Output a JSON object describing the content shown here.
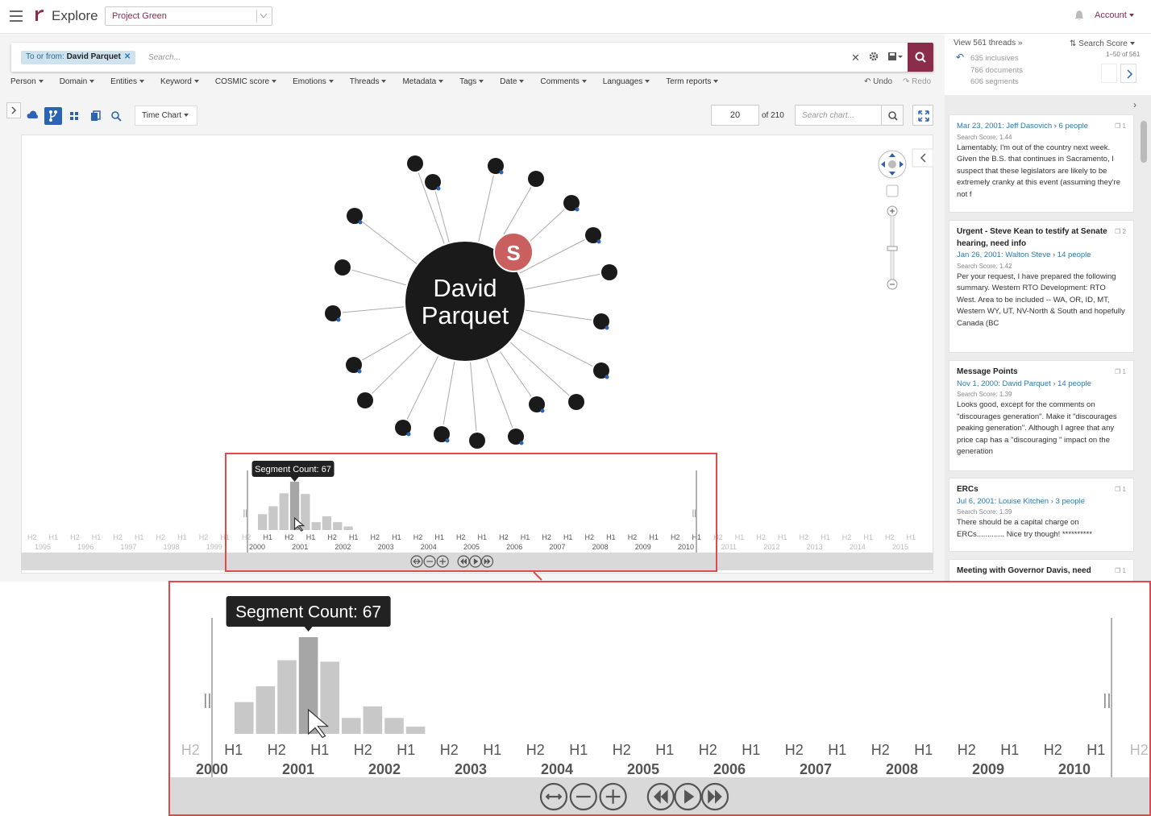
{
  "app": {
    "title": "Explore",
    "project": "Project Green",
    "account_label": "Account"
  },
  "search": {
    "chip_prefix": "To or from:",
    "chip_value": "David Parquet",
    "placeholder": "Search..."
  },
  "filters": [
    "Person",
    "Domain",
    "Entities",
    "Keyword",
    "COSMIC score",
    "Emotions",
    "Threads",
    "Metadata",
    "Tags",
    "Date",
    "Comments",
    "Languages",
    "Term reports"
  ],
  "history": {
    "undo": "Undo",
    "redo": "Redo"
  },
  "toolbar": {
    "chart_type": "Time Chart",
    "page_value": "20",
    "page_of": "of 210",
    "chart_search_placeholder": "Search chart..."
  },
  "graph": {
    "center_line1": "David",
    "center_line2": "Parquet",
    "badge": "S"
  },
  "sidebar": {
    "threads_link": "View 561 threads »",
    "sort_label": "Search Score",
    "stats": [
      "635 inclusives",
      "766 documents",
      "606 segments"
    ],
    "range": "1–50 of 561",
    "cards": [
      {
        "title": "",
        "meta": "Mar 23, 2001: Jeff Dasovich › 6 people",
        "score": "Search Score: 1.44",
        "count": "1",
        "body": "Lamentably, I'm out of the country next week. Given the B.S. that continues in Sacramento, I suspect that these legislators are likely to be extremely cranky at this event (assuming they're not f"
      },
      {
        "title": "Urgent - Steve Kean to testify at Senate hearing, need info",
        "meta": "Jan 26, 2001: Walton Steve › 14 people",
        "score": "Search Score: 1.42",
        "count": "2",
        "body": "Per your request, I have prepared the following summary. Western RTO Development: RTO West. Area to be included -- WA, OR, ID, MT, Western WY, UT, NV-North & South and hopefully Canada (BC"
      },
      {
        "title": "Message Points",
        "meta": "Nov 1, 2000: David Parquet › 14 people",
        "score": "Search Score: 1.39",
        "count": "1",
        "body": "Looks good, except for the comments on \"discourages generation\". Make it \"discourages peaking generation\". Although I agree that any price cap has a \"discouraging \" impact on the generation"
      },
      {
        "title": "ERCs",
        "meta": "Jul 6, 2001: Louise Kitchen › 3 people",
        "score": "Search Score: 1.39",
        "count": "1",
        "body": "There should be a capital charge on ERCs............. Nice try though! **********"
      },
      {
        "title": "Meeting with Governor Davis, need",
        "meta": "",
        "score": "",
        "count": "1",
        "body": ""
      }
    ]
  },
  "timeline": {
    "tooltip": "Segment Count: 67",
    "half_labels": [
      "H1",
      "H2"
    ],
    "years": [
      "1995",
      "1996",
      "1997",
      "1998",
      "1999",
      "2000",
      "2001",
      "2002",
      "2003",
      "2004",
      "2005",
      "2006",
      "2007",
      "2008",
      "2009",
      "2010",
      "2011",
      "2012",
      "2013",
      "2014",
      "2015"
    ],
    "first_label": "2",
    "big_first_half": "H2",
    "big_first_year": "99"
  },
  "chart_data": {
    "type": "bar",
    "title": "",
    "categories": [
      "2000 H1",
      "2000 H2",
      "2001 H1",
      "2001 H2",
      "2002 H1",
      "2002 H2",
      "2003 H1",
      "2003 H2"
    ],
    "values": [
      22,
      33,
      51,
      67,
      50,
      11,
      19,
      11,
      5
    ],
    "highlighted_category": "2001 H1",
    "highlighted_value": 67
  },
  "colors": {
    "brand": "#8a2d4a",
    "active": "#2b64b5",
    "link": "#2a7ab0",
    "highlight_box": "#e04a4a",
    "bar": "#c8c8c8",
    "bar_selected": "#a6a6a6"
  }
}
